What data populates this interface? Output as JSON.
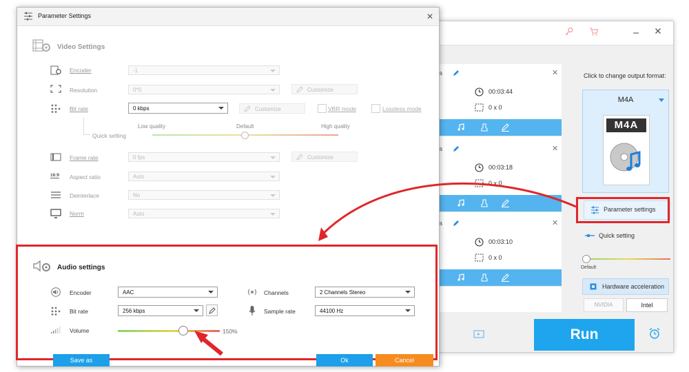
{
  "background_window": {
    "cards": [
      {
        "fragment": "a",
        "duration": "00:03:44",
        "resolution": "0 x 0"
      },
      {
        "fragment": "a",
        "duration": "00:03:18",
        "resolution": "0 x 0"
      },
      {
        "fragment": "a",
        "duration": "00:03:10",
        "resolution": "0 x 0"
      }
    ],
    "change_format_label": "Click to change output format:",
    "output_format": "M4A",
    "format_icon_text": "M4A",
    "parameter_settings_label": "Parameter settings",
    "quick_setting_label": "Quick setting",
    "quick_setting_default": "Default",
    "hardware_acceleration_label": "Hardware acceleration",
    "nvidia_label": "NVIDIA",
    "intel_label": "Intel",
    "run_label": "Run"
  },
  "dialog": {
    "title": "Parameter Settings",
    "video": {
      "section_title": "Video Settings",
      "encoder_label": "Encoder",
      "encoder_value": "-1",
      "resolution_label": "Resolution",
      "resolution_value": "0*0",
      "resolution_customize": "Customize",
      "bitrate_label": "Bit rate",
      "bitrate_value": "0 kbps",
      "bitrate_customize": "Customize",
      "vbr_label": "VBR mode",
      "lossless_label": "Lossless mode",
      "quick_setting_label": "Quick setting",
      "quality_low": "Low quality",
      "quality_default": "Default",
      "quality_high": "High quality",
      "framerate_label": "Frame rate",
      "framerate_value": "0 fps",
      "framerate_customize": "Customize",
      "aspect_label": "Aspect ratio",
      "aspect_value": "Auto",
      "aspect_icon_text": "16:9",
      "deinterlace_label": "Deinterlace",
      "deinterlace_value": "No",
      "norm_label": "Norm",
      "norm_value": "Auto"
    },
    "audio": {
      "section_title": "Audio settings",
      "encoder_label": "Encoder",
      "encoder_value": "AAC",
      "channels_label": "Channels",
      "channels_value": "2 Channels Stereo",
      "bitrate_label": "Bit rate",
      "bitrate_value": "256 kbps",
      "samplerate_label": "Sample rate",
      "samplerate_value": "44100 Hz",
      "volume_label": "Volume",
      "volume_percent": "150%",
      "volume_level": 0.67
    },
    "save_as_label": "Save as",
    "ok_label": "Ok",
    "cancel_label": "Cancel"
  },
  "colors": {
    "accent_blue": "#1ea5ee",
    "annotation_red": "#e0262b",
    "cancel_orange": "#f68b1f"
  }
}
